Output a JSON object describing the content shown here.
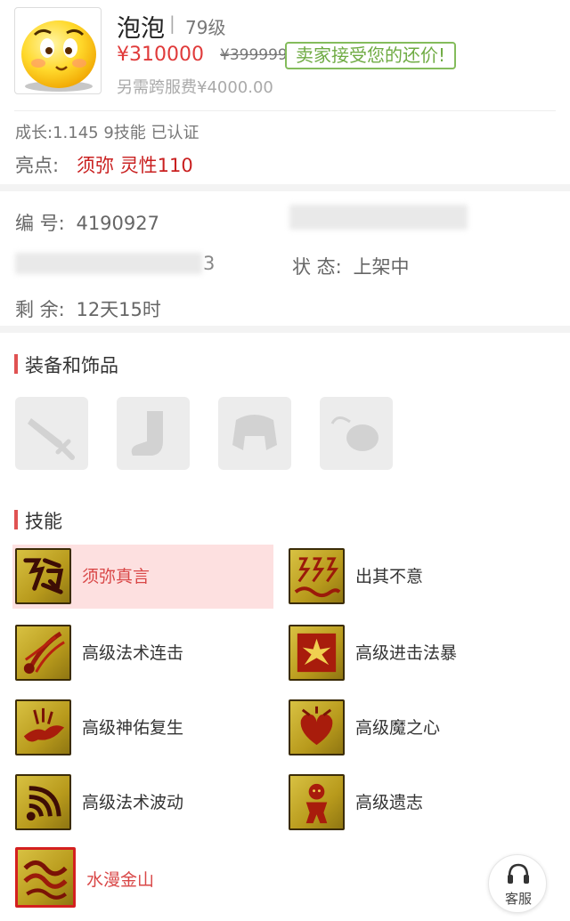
{
  "pet": {
    "name": "泡泡",
    "separator": "|",
    "level": "79级",
    "price": "¥310000",
    "original_price": "¥399999",
    "accept_tag": "卖家接受您的还价!",
    "cross_server_fee": "另需跨服费¥4000.00",
    "growth": "成长:1.145 9技能 已认证",
    "highlight_label": "亮点:",
    "highlight_value": "须弥 灵性110"
  },
  "info": {
    "id_label": "编  号:",
    "id_value": "4190927",
    "status_label": "状  态:",
    "status_value": "上架中",
    "remaining_label": "剩  余:",
    "remaining_value": "12天15时",
    "blur_tail": "3"
  },
  "equipment": {
    "title": "装备和饰品",
    "slots": [
      "weapon-slot",
      "boots-slot",
      "armor-slot",
      "accessory-slot"
    ]
  },
  "skills": {
    "title": "技能",
    "items": [
      {
        "name": "须弥真言",
        "icon": "rune-icon"
      },
      {
        "name": "出其不意",
        "icon": "lightning-icon"
      },
      {
        "name": "高级法术连击",
        "icon": "comet-icon"
      },
      {
        "name": "高级进击法暴",
        "icon": "burst-icon"
      },
      {
        "name": "高级神佑复生",
        "icon": "phoenix-icon"
      },
      {
        "name": "高级魔之心",
        "icon": "heart-icon"
      },
      {
        "name": "高级法术波动",
        "icon": "wave-icon"
      },
      {
        "name": "高级遗志",
        "icon": "figure-icon"
      },
      {
        "name": "水漫金山",
        "icon": "water-icon"
      }
    ]
  },
  "service": {
    "label": "客服"
  },
  "colors": {
    "price_red": "#e03a3a",
    "accept_green": "#6fab43",
    "highlight_red": "#c91f1f",
    "active_skill_bg": "#fde0e0",
    "section_accent": "#e05252"
  }
}
